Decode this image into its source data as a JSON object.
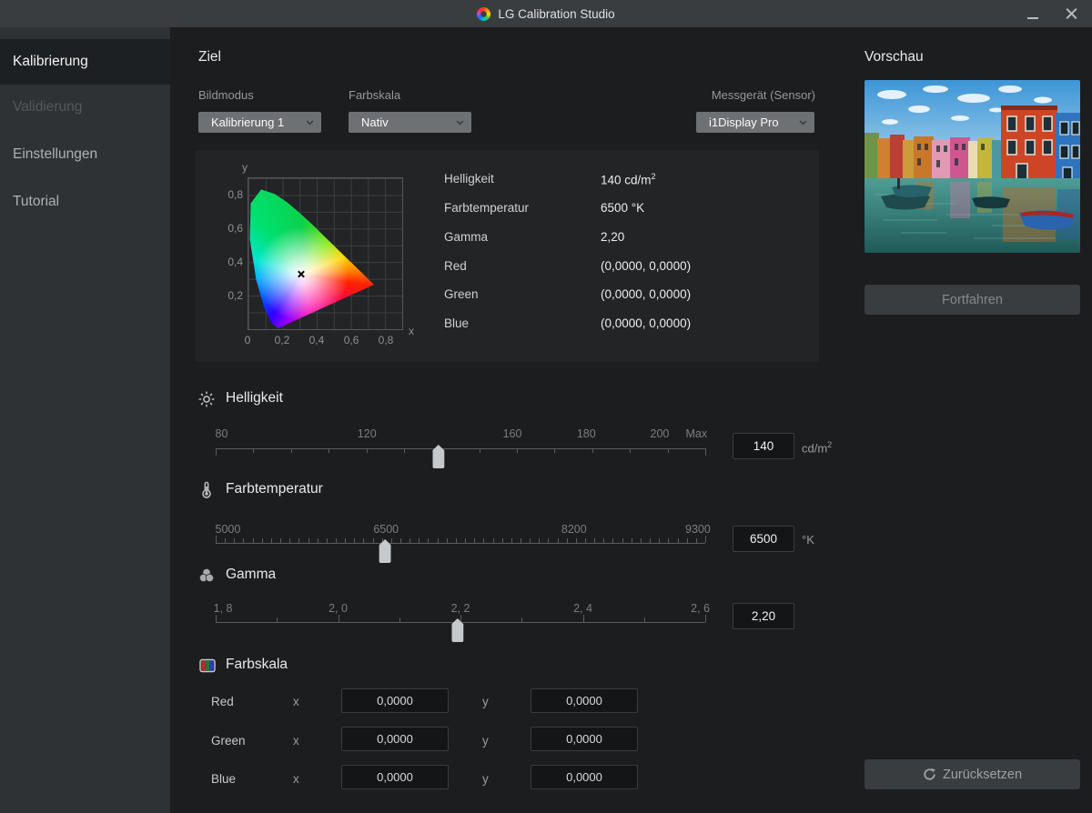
{
  "titlebar": {
    "title": "LG Calibration Studio"
  },
  "sidebar": {
    "items": [
      {
        "label": "Kalibrierung",
        "state": "active"
      },
      {
        "label": "Validierung",
        "state": "disabled"
      },
      {
        "label": "Einstellungen",
        "state": "normal"
      },
      {
        "label": "Tutorial",
        "state": "normal"
      }
    ]
  },
  "target": {
    "section_title": "Ziel",
    "fields": [
      {
        "label": "Bildmodus",
        "value": "Kalibrierung 1"
      },
      {
        "label": "Farbskala",
        "value": "Nativ"
      },
      {
        "label": "Messgerät (Sensor)",
        "value": "i1Display Pro"
      }
    ]
  },
  "chart_data": {
    "type": "scatter",
    "title": "CIE 1931 xy chromaticity diagram with target white point",
    "xlabel": "x",
    "ylabel": "y",
    "xlim": [
      0,
      0.9
    ],
    "ylim": [
      0,
      0.9
    ],
    "grid": true,
    "x_ticks": [
      {
        "text": "0",
        "pct": 0
      },
      {
        "text": "0,2",
        "pct": 22.2
      },
      {
        "text": "0,4",
        "pct": 44.4
      },
      {
        "text": "0,6",
        "pct": 66.7
      },
      {
        "text": "0,8",
        "pct": 88.9
      }
    ],
    "y_ticks": [
      {
        "text": "0,2",
        "pct": 22.2
      },
      {
        "text": "0,4",
        "pct": 44.4
      },
      {
        "text": "0,6",
        "pct": 66.7
      },
      {
        "text": "0,8",
        "pct": 88.9
      }
    ],
    "series": [
      {
        "name": "white-point",
        "marker": "x",
        "points": [
          {
            "x": 0.31,
            "y": 0.33
          }
        ]
      }
    ]
  },
  "readout": {
    "rows": [
      {
        "label": "Helligkeit",
        "value": "140 cd/m",
        "sup": "2"
      },
      {
        "label": "Farbtemperatur",
        "value": "6500 °K"
      },
      {
        "label": "Gamma",
        "value": "2,20"
      },
      {
        "label": "Red",
        "value": "(0,0000, 0,0000)"
      },
      {
        "label": "Green",
        "value": "(0,0000, 0,0000)"
      },
      {
        "label": "Blue",
        "value": "(0,0000, 0,0000)"
      }
    ]
  },
  "sliders": [
    {
      "name": "Helligkeit",
      "icon": "sun-icon",
      "value": "140",
      "unit": "cd/m",
      "unit_sup": "2",
      "labels": [
        {
          "text": "80",
          "pct": 1.2
        },
        {
          "text": "120",
          "pct": 30.9
        },
        {
          "text": "160",
          "pct": 60.6
        },
        {
          "text": "180",
          "pct": 75.7
        },
        {
          "text": "200",
          "pct": 90.7
        },
        {
          "text": "Max",
          "pct": 98.2
        }
      ],
      "handle_pct": 45.5,
      "minor_ticks": 14,
      "tick_dir": "down"
    },
    {
      "name": "Farbtemperatur",
      "icon": "thermometer-icon",
      "value": "6500",
      "unit": "°K",
      "labels": [
        {
          "text": "5000",
          "pct": 2.5
        },
        {
          "text": "6500",
          "pct": 34.8
        },
        {
          "text": "8200",
          "pct": 73.2
        },
        {
          "text": "9300",
          "pct": 98.5
        }
      ],
      "handle_pct": 34.6,
      "minor_ticks": 54,
      "tick_dir": "up"
    },
    {
      "name": "Gamma",
      "icon": "gamma-icon",
      "value": "2,20",
      "unit": "",
      "labels": [
        {
          "text": "1, 8",
          "pct": 1.5
        },
        {
          "text": "2, 0",
          "pct": 25
        },
        {
          "text": "2, 2",
          "pct": 50
        },
        {
          "text": "2, 4",
          "pct": 75
        },
        {
          "text": "2, 6",
          "pct": 99
        }
      ],
      "handle_pct": 49.4,
      "minor_ticks": 9,
      "tick_dir": "up"
    }
  ],
  "gamut": {
    "title": "Farbskala",
    "icon": "rgb-stripes-icon",
    "x_label": "x",
    "y_label": "y",
    "rows": [
      {
        "label": "Red",
        "x": "0,0000",
        "y": "0,0000"
      },
      {
        "label": "Green",
        "x": "0,0000",
        "y": "0,0000"
      },
      {
        "label": "Blue",
        "x": "0,0000",
        "y": "0,0000"
      }
    ]
  },
  "preview": {
    "title": "Vorschau",
    "image": "burano-canal-colorful-houses",
    "continue_label": "Fortfahren",
    "reset_label": "Zurücksetzen"
  },
  "colors": {
    "titlebar_bg": "#3a3d40",
    "sidebar_bg": "#2f3235",
    "sidebar_active_bg": "#1d2023",
    "main_bg": "#1b1d1f",
    "panel_bg": "#222426",
    "dropdown_bg": "#6e7173",
    "input_bg": "#131516",
    "button_bg": "#3a3d40",
    "accent_text": "#e9eaeb",
    "muted_text": "#97999b"
  }
}
